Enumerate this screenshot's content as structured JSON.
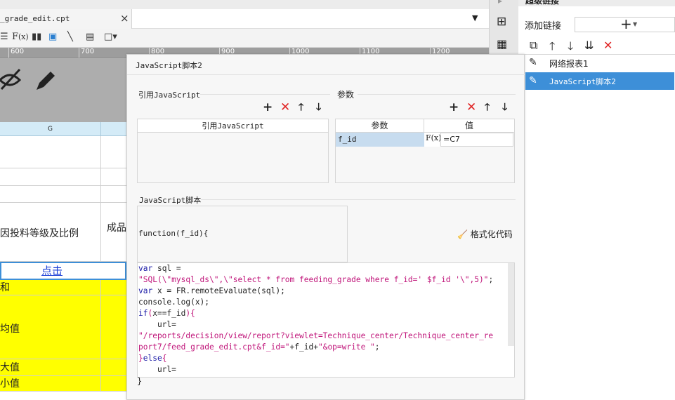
{
  "editor": {
    "tab_title": "_grade_edit.cpt",
    "tab_close": "×",
    "ruler_ticks": [
      "600",
      "700",
      "800",
      "900",
      "1000",
      "1100",
      "1200"
    ],
    "col_header": "G",
    "cells": {
      "row_label": "因投料等级及比例",
      "row_label_b": "成品",
      "click_link": "点击",
      "sum": "和",
      "avg": "均值",
      "max": "大值",
      "min": "小值"
    }
  },
  "dialog": {
    "title": "JavaScript脚本2",
    "ref_section": "引用JavaScript",
    "ref_column": "引用JavaScript",
    "param_section": "参数",
    "param_columns": [
      "参数",
      "值"
    ],
    "param_rows": [
      {
        "name": "f_id",
        "formula_icon": "F(x)",
        "value": "=C7"
      }
    ],
    "script_section": "JavaScript脚本",
    "function_sig": "function(f_id){",
    "format_button": "格式化代码",
    "closing_brace": "}",
    "code_lines": [
      "var sql =",
      "\"SQL(\\\"mysql_ds\\\",\\\"select * from feeding_grade where f_id=' $f_id '\\\",5)\";",
      "var x = FR.remoteEvaluate(sql);",
      "console.log(x);",
      "if(x==f_id){",
      "    url=",
      "\"/reports/decision/view/report?viewlet=Technique_center/Technique_center_re",
      "port7/feed_grade_edit.cpt&f_id=\"+f_id+\"&op=write \";",
      "}else{",
      "    url="
    ]
  },
  "right_panel": {
    "header": "超级链接",
    "add_link_label": "添加链接",
    "add_button": "+",
    "links": [
      "网络报表1",
      "JavaScript脚本2"
    ],
    "selected_index": 1
  },
  "colors": {
    "accent": "#3d8fd8",
    "yellow": "#ffff00",
    "delete": "#e02424"
  }
}
